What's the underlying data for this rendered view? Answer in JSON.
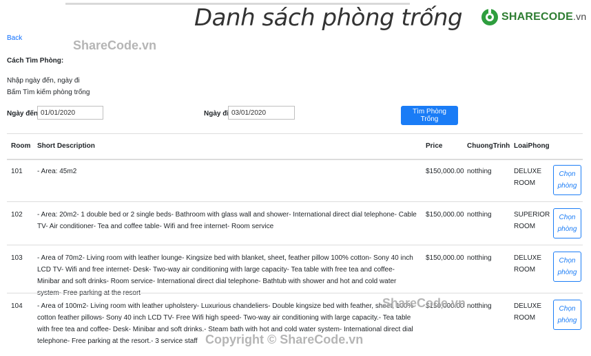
{
  "header": {
    "title": "Danh sách phòng trống",
    "logo_brand": "SHARECODE",
    "logo_domain": ".vn"
  },
  "watermarks": {
    "top": "ShareCode.vn",
    "middle": "ShareCode.vn",
    "bottom": "Copyright © ShareCode.vn"
  },
  "nav": {
    "back": "Back"
  },
  "instructions": {
    "heading": "Cách Tìm Phòng:",
    "step1": "Nhập ngày đến, ngày đi",
    "step2": "Bấm Tìm kiếm phòng trống"
  },
  "form": {
    "from_label": "Ngày đến:",
    "from_value": "01/01/2020",
    "to_label": "Ngày đi:",
    "to_value": "03/01/2020",
    "search_button": "Tìm Phòng Trống"
  },
  "table": {
    "headers": {
      "room": "Room",
      "desc": "Short Description",
      "price": "Price",
      "program": "ChuongTrinh",
      "type": "LoaiPhong"
    },
    "choose_label": "Chọn phòng",
    "rows": [
      {
        "room": "101",
        "desc": "- Area: 45m2",
        "price": "$150,000.00",
        "program": "notthing",
        "type": "DELUXE ROOM"
      },
      {
        "room": "102",
        "desc": "- Area: 20m2- 1 double bed or 2 single beds- Bathroom with glass wall and shower- International direct dial telephone- Cable TV- Air conditioner- Tea and coffee table- Wifi and free internet- Room service",
        "price": "$150,000.00",
        "program": "notthing",
        "type": "SUPERIOR ROOM"
      },
      {
        "room": "103",
        "desc": "- Area of 70m2- Living room with leather lounge- Kingsize bed with blanket, sheet, feather pillow 100% cotton- Sony 40 inch LCD TV- Wifi and free internet- Desk- Two-way air conditioning with large capacity- Tea table with free tea and coffee- Minibar and soft drinks- Room service- International direct dial telephone- Bathtub with shower and hot and cold water system- Free parking at the resort",
        "price": "$150,000.00",
        "program": "notthing",
        "type": "DELUXE ROOM"
      },
      {
        "room": "104",
        "desc": "- Area of 100m2- Living room with leather upholstery- Luxurious chandeliers- Double kingsize bed with feather, sheet, 100% cotton feather pillows- Sony 40 inch LCD TV- Free Wifi high speed- Two-way air conditioning with large capacity.- Tea table with free tea and coffee- Desk- Minibar and soft drinks.- Steam bath with hot and cold water system- International direct dial telephone- Free parking at the resort.- 3 service staff",
        "price": "$150,000.00",
        "program": "notthing",
        "type": "DELUXE ROOM"
      }
    ]
  }
}
